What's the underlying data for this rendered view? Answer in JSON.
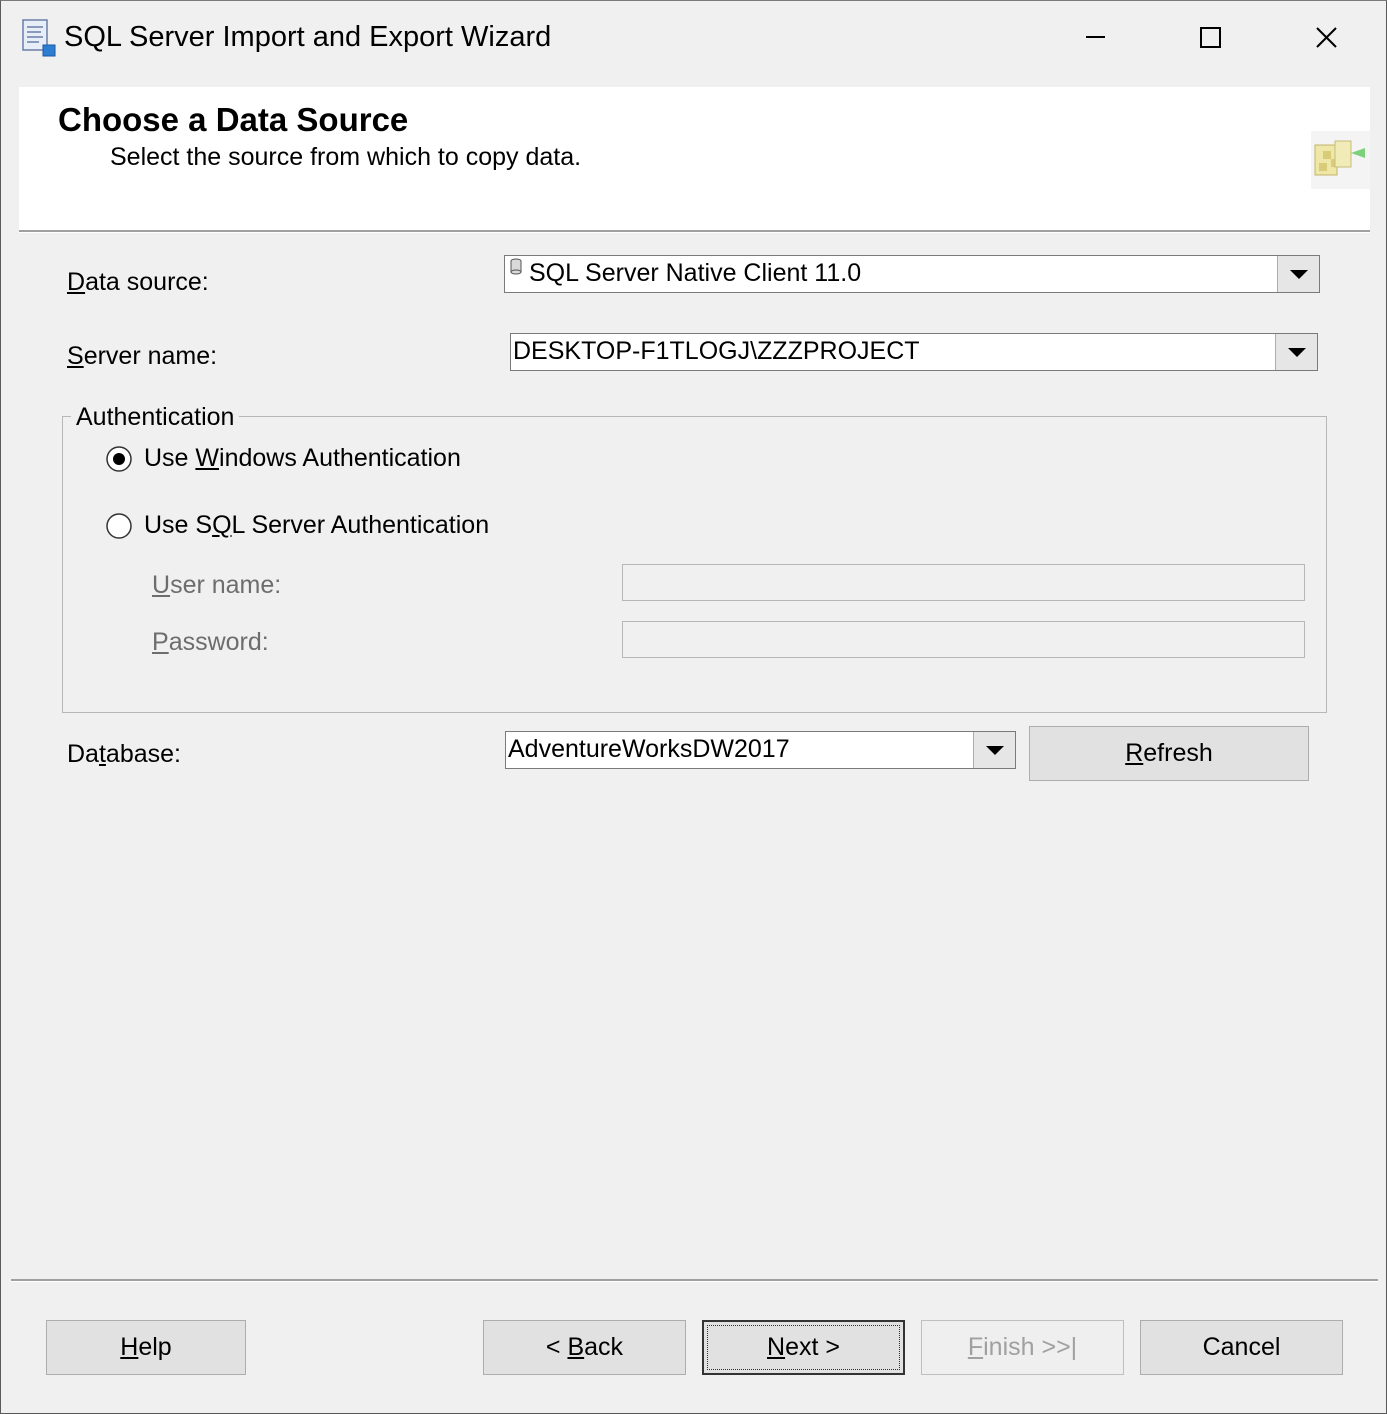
{
  "window": {
    "title": "SQL Server Import and Export Wizard",
    "minimize_icon": "minimize-icon",
    "maximize_icon": "maximize-icon",
    "close_icon": "close-icon"
  },
  "header": {
    "title": "Choose a Data Source",
    "subtitle": "Select the source from which to copy data."
  },
  "form": {
    "data_source": {
      "label_mnemonic": "D",
      "label_rest": "ata source:",
      "value": "SQL Server Native Client 11.0",
      "icon": "database-driver-icon"
    },
    "server_name": {
      "label_mnemonic": "S",
      "label_rest": "erver name:",
      "value": "DESKTOP-F1TLOGJ\\ZZZPROJECT"
    },
    "authentication": {
      "group_label": "Authentication",
      "windows": {
        "label_pre": "Use ",
        "label_mnemonic": "W",
        "label_post": "indows Authentication",
        "selected": true
      },
      "sql": {
        "label_pre": "Use S",
        "label_mnemonic": "Q",
        "label_post": "L Server Authentication",
        "selected": false
      },
      "user_name": {
        "label_mnemonic": "U",
        "label_rest": "ser name:",
        "value": ""
      },
      "password": {
        "label_mnemonic": "P",
        "label_rest": "assword:",
        "value": ""
      }
    },
    "database": {
      "label_pre": "Da",
      "label_mnemonic": "t",
      "label_post": "abase:",
      "value": "AdventureWorksDW2017"
    },
    "refresh": {
      "label_mnemonic": "R",
      "label_rest": "efresh"
    }
  },
  "footer": {
    "help": {
      "label_mnemonic": "H",
      "label_rest": "elp"
    },
    "back": {
      "label_pre": "< ",
      "label_mnemonic": "B",
      "label_rest": "ack"
    },
    "next": {
      "label_mnemonic": "N",
      "label_rest": "ext >"
    },
    "finish": {
      "label_mnemonic": "F",
      "label_rest": "inish >>|",
      "enabled": false
    },
    "cancel": {
      "label": "Cancel"
    }
  }
}
